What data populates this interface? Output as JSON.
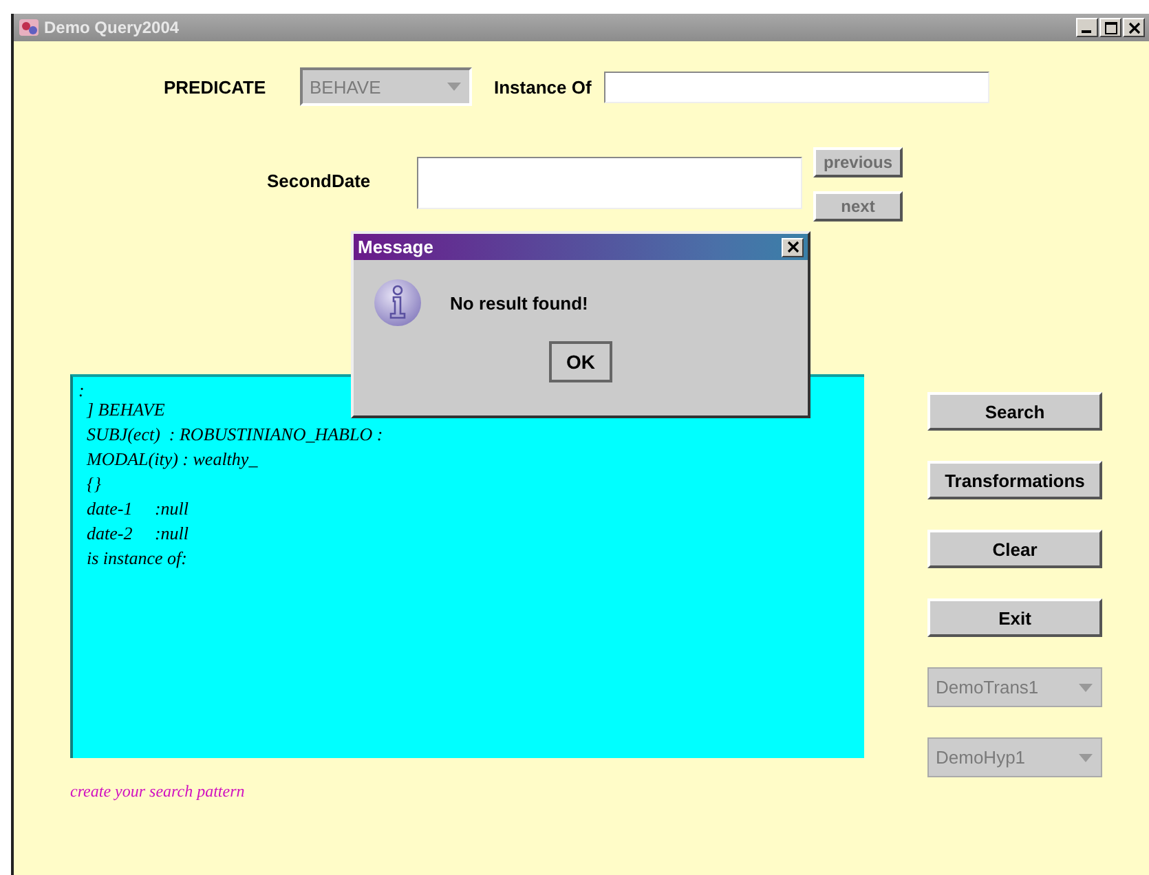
{
  "window": {
    "title": "Demo Query2004"
  },
  "predicate": {
    "label": "PREDICATE",
    "value": "BEHAVE",
    "disabled": true
  },
  "instance_of": {
    "label": "Instance Of"
  },
  "second_date": {
    "label": "SecondDate"
  },
  "nav_buttons": [
    {
      "label": "previous",
      "disabled": true
    },
    {
      "label": "next",
      "disabled": true
    }
  ],
  "output": {
    "lines": [
      ":",
      "] BEHAVE",
      "SUBJ(ect)  : ROBUSTINIANO_HABLO :",
      "MODAL(ity) : wealthy_",
      "{}",
      "date-1     :null",
      "date-2     :null",
      "is instance of:"
    ]
  },
  "actions": [
    {
      "label": "Search"
    },
    {
      "label": "Transformations"
    },
    {
      "label": "Clear"
    },
    {
      "label": "Exit"
    }
  ],
  "dropdowns": [
    {
      "value": "DemoTrans1",
      "disabled": true
    },
    {
      "value": "DemoHyp1",
      "disabled": true
    }
  ],
  "hint": "create your search pattern",
  "dialog": {
    "title": "Message",
    "message": "No result found!",
    "button": "OK"
  }
}
